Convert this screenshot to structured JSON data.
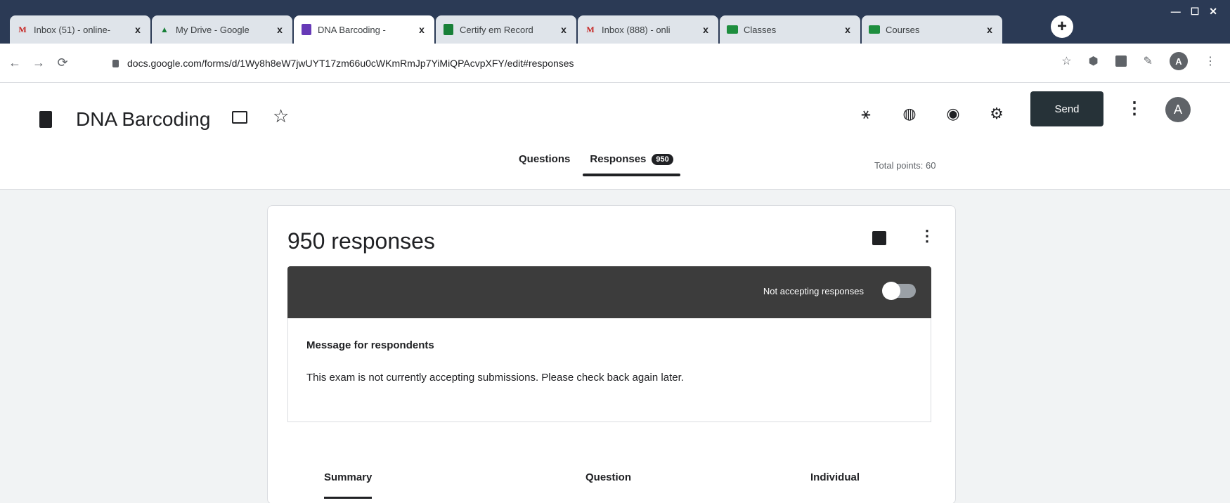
{
  "browser": {
    "tabs": [
      {
        "label": "Inbox (51) - online-",
        "icon": "gmail-icon"
      },
      {
        "label": "My Drive - Google",
        "icon": "drive-icon"
      },
      {
        "label": "DNA Barcoding -",
        "icon": "forms-icon"
      },
      {
        "label": "Certify em Record",
        "icon": "sheets-icon"
      },
      {
        "label": "Inbox (888) - onli",
        "icon": "gmail-icon"
      },
      {
        "label": "Classes",
        "icon": "classroom-icon"
      },
      {
        "label": "Courses",
        "icon": "classroom-icon"
      }
    ],
    "close_symbol": "x",
    "new_tab_symbol": "+",
    "url": "docs.google.com/forms/d/1Wy8h8eW7jwUYT17zm66u0cWKmRmJp7YiMiQPAcvpXFY/edit#responses",
    "avatar_letter": "A"
  },
  "header": {
    "title": "DNA Barcoding",
    "send_label": "Send",
    "avatar_letter": "A",
    "tabs": {
      "questions": "Questions",
      "responses": "Responses",
      "responses_count": "950"
    },
    "total_points": "Total points: 60"
  },
  "responses": {
    "title": "950 responses",
    "status_label": "Not accepting responses",
    "message_heading": "Message for respondents",
    "message_text": "This exam is not currently accepting submissions. Please check back again later.",
    "views": {
      "summary": "Summary",
      "question": "Question",
      "individual": "Individual"
    }
  },
  "colors": {
    "status_bar": "#3c3c3c",
    "send_button": "#263238"
  }
}
